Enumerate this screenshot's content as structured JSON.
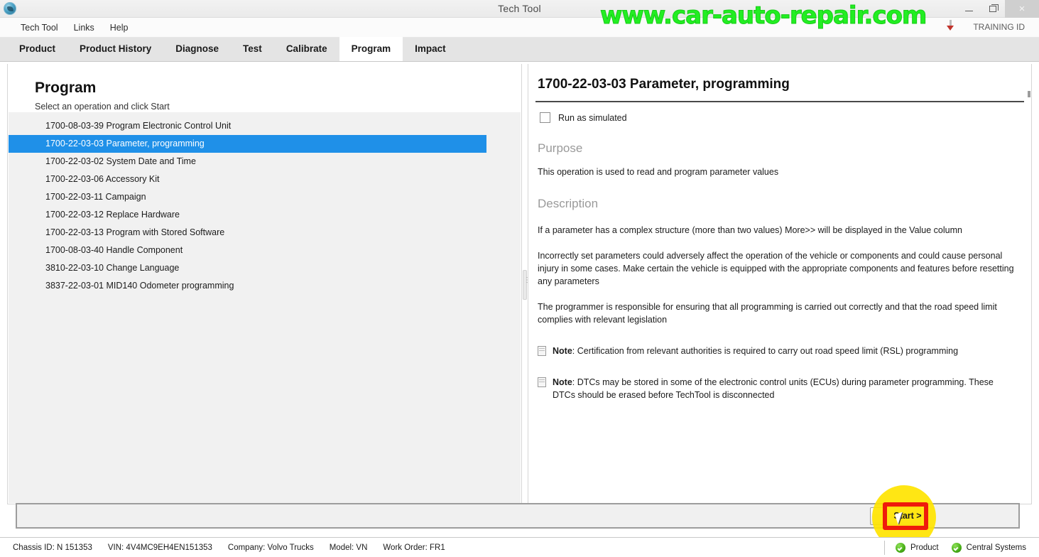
{
  "window": {
    "title": "Tech Tool",
    "icon": "globe-icon",
    "minimize_label": "–",
    "maximize_label": "❐",
    "close_label": "×"
  },
  "watermark": {
    "text": "www.car-auto-repair.com",
    "color": "#22ee22"
  },
  "training": {
    "label": "TRAINING ID"
  },
  "menubar": {
    "items": [
      {
        "label": "Tech Tool"
      },
      {
        "label": "Links"
      },
      {
        "label": "Help"
      }
    ]
  },
  "tabs": {
    "active": "Program",
    "items": [
      {
        "label": "Product"
      },
      {
        "label": "Product History"
      },
      {
        "label": "Diagnose"
      },
      {
        "label": "Test"
      },
      {
        "label": "Calibrate"
      },
      {
        "label": "Program"
      },
      {
        "label": "Impact"
      }
    ]
  },
  "left_pane": {
    "title": "Program",
    "subtitle": "Select an operation and click Start",
    "selected_index": 1,
    "operations": [
      {
        "label": "1700-08-03-39 Program Electronic Control Unit"
      },
      {
        "label": "1700-22-03-03 Parameter, programming"
      },
      {
        "label": "1700-22-03-02 System Date and Time"
      },
      {
        "label": "1700-22-03-06 Accessory Kit"
      },
      {
        "label": "1700-22-03-11 Campaign"
      },
      {
        "label": "1700-22-03-12 Replace Hardware"
      },
      {
        "label": "1700-22-03-13 Program with Stored Software"
      },
      {
        "label": "1700-08-03-40 Handle Component"
      },
      {
        "label": "3810-22-03-10 Change Language"
      },
      {
        "label": "3837-22-03-01 MID140 Odometer programming"
      }
    ],
    "selection_color": "#1f90e8"
  },
  "right_pane": {
    "title": "1700-22-03-03 Parameter, programming",
    "simulate_checkbox": {
      "label": "Run as simulated",
      "checked": false
    },
    "purpose_heading": "Purpose",
    "purpose_text": "This operation is used to read and program parameter values",
    "description_heading": "Description",
    "paragraphs": [
      "If a parameter has a complex structure (more than two values) More>> will be displayed in the Value column",
      "Incorrectly set parameters could adversely affect the operation of the vehicle or components and could cause personal injury in some cases. Make certain the vehicle is equipped with the appropriate components and features before resetting any parameters",
      "The programmer is responsible for ensuring that all programming is carried out correctly and that the road speed limit complies with relevant legislation"
    ],
    "notes": [
      {
        "prefix": "Note",
        "text": ": Certification from relevant authorities is required to carry out road speed limit (RSL) programming"
      },
      {
        "prefix": "Note",
        "text": ": DTCs may be stored in some of the electronic control units (ECUs) during parameter programming. These DTCs should be erased before TechTool is disconnected"
      }
    ]
  },
  "toolbar": {
    "start_label": "Start >"
  },
  "annotation": {
    "highlight_color": "#ffe400",
    "box_color": "#ef1b0b"
  },
  "statusbar": {
    "chips": [
      {
        "label": "Chassis ID: N 151353"
      },
      {
        "label": "VIN: 4V4MC9EH4EN151353"
      },
      {
        "label": "Company: Volvo Trucks"
      },
      {
        "label": "Model: VN"
      },
      {
        "label": "Work Order: FR1"
      }
    ],
    "indicators": [
      {
        "label": "Product",
        "status": "ok"
      },
      {
        "label": "Central Systems",
        "status": "ok"
      }
    ]
  }
}
